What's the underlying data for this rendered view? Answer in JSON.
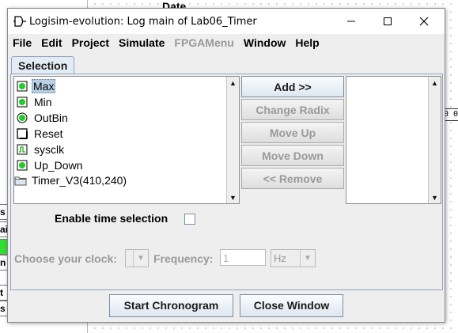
{
  "background": {
    "date_label": "Date",
    "left_cells": [
      "s",
      "ai",
      "",
      "n",
      "t",
      "s"
    ],
    "right_label": "0 0"
  },
  "window": {
    "title": "Logisim-evolution: Log main of Lab06_Timer",
    "controls": {
      "minimize": "minimize-icon",
      "maximize": "maximize-icon",
      "close": "close-icon"
    }
  },
  "menu": [
    {
      "label": "File",
      "enabled": true
    },
    {
      "label": "Edit",
      "enabled": true
    },
    {
      "label": "Project",
      "enabled": true
    },
    {
      "label": "Simulate",
      "enabled": true
    },
    {
      "label": "FPGAMenu",
      "enabled": false
    },
    {
      "label": "Window",
      "enabled": true
    },
    {
      "label": "Help",
      "enabled": true
    }
  ],
  "tab": {
    "label": "Selection"
  },
  "signals": [
    {
      "label": "Max",
      "icon": "pin-output-icon",
      "selected": true
    },
    {
      "label": "Min",
      "icon": "pin-output-icon",
      "selected": false
    },
    {
      "label": "OutBin",
      "icon": "pin-round-icon",
      "selected": false
    },
    {
      "label": "Reset",
      "icon": "pin-input-icon",
      "selected": false
    },
    {
      "label": "sysclk",
      "icon": "clock-icon",
      "selected": false
    },
    {
      "label": "Up_Down",
      "icon": "pin-output-icon",
      "selected": false
    },
    {
      "label": "Timer_V3(410,240)",
      "icon": "folder-icon",
      "selected": false
    }
  ],
  "actions": {
    "add": "Add >>",
    "change_radix": "Change Radix",
    "move_up": "Move Up",
    "move_down": "Move Down",
    "remove": "<< Remove"
  },
  "options": {
    "enable_time_selection": "Enable time selection",
    "choose_clock": "Choose your clock:",
    "frequency": "Frequency:",
    "frequency_value": "1",
    "frequency_unit": "Hz"
  },
  "buttons": {
    "start": "Start Chronogram",
    "close": "Close Window"
  },
  "colors": {
    "pin_green": "#22cc22",
    "tab_bg": "#e3ebf5",
    "selection": "#b8cfe5"
  }
}
